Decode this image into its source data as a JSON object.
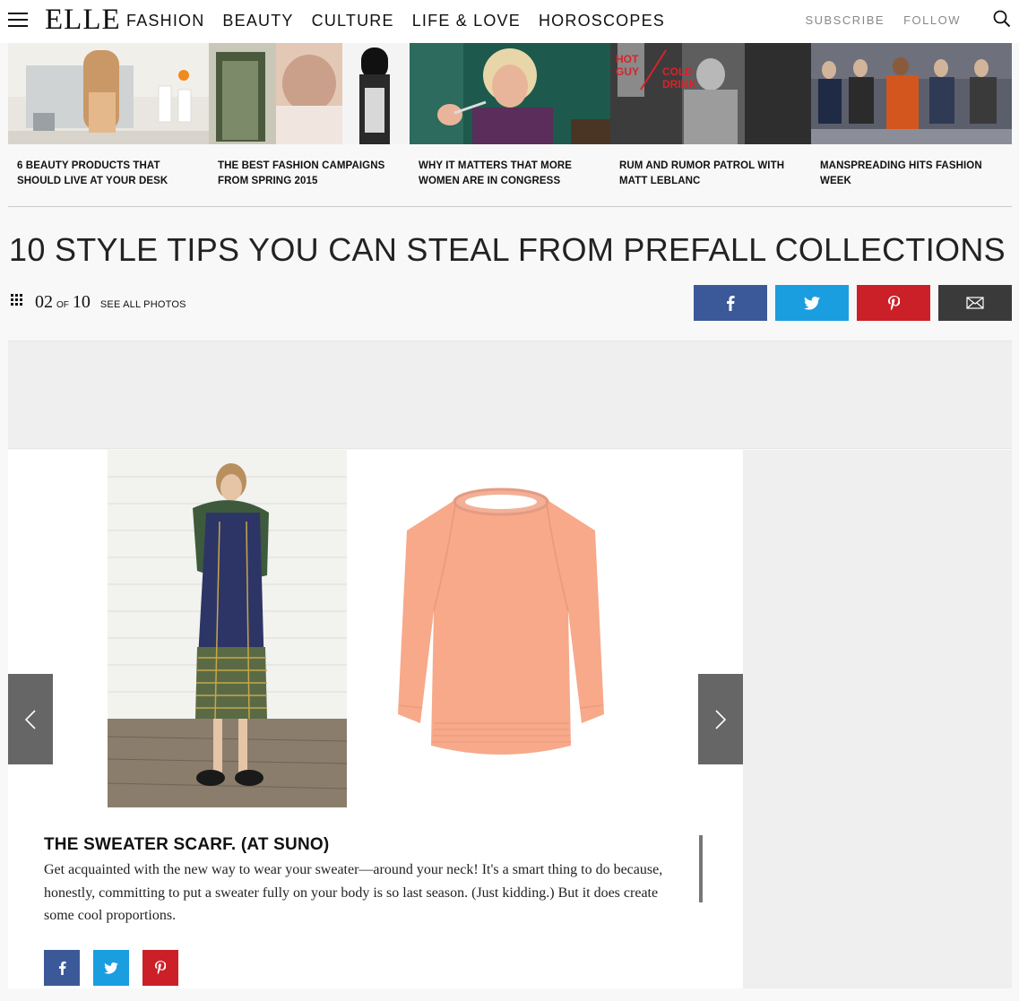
{
  "header": {
    "logo": "ELLE",
    "nav": [
      "FASHION",
      "BEAUTY",
      "CULTURE",
      "LIFE & LOVE",
      "HOROSCOPES"
    ],
    "subscribe": "SUBSCRIBE",
    "follow": "FOLLOW"
  },
  "promos": [
    {
      "caption": "6 BEAUTY PRODUCTS THAT SHOULD LIVE AT YOUR DESK"
    },
    {
      "caption": "THE BEST FASHION CAMPAIGNS FROM SPRING 2015"
    },
    {
      "caption": "WHY IT MATTERS THAT MORE WOMEN ARE IN CONGRESS"
    },
    {
      "caption": "RUM AND RUMOR PATROL WITH MATT LEBLANC",
      "overlay_text": [
        "HOT",
        "GUY",
        "COLD",
        "DRINK"
      ]
    },
    {
      "caption": "MANSPREADING HITS FASHION WEEK"
    }
  ],
  "gallery": {
    "title": "10 STYLE TIPS YOU CAN STEAL FROM PREFALL COLLECTIONS",
    "current": "02",
    "of": "OF",
    "total": "10",
    "see_all": "SEE ALL PHOTOS"
  },
  "slide": {
    "title": "THE SWEATER SCARF. (AT SUNO)",
    "body": "Get acquainted with the new way to wear your sweater—around your neck! It's a smart thing to do because, honestly, committing to put a sweater fully on your body is so last season. (Just kidding.) But it does create some cool proportions."
  },
  "colors": {
    "facebook": "#3b5998",
    "twitter": "#1a9ee0",
    "pinterest": "#cb2027",
    "email": "#3a3a3a",
    "sweater": "#f7a98a"
  },
  "icons": [
    "menu-icon",
    "search-icon",
    "grid-icon",
    "facebook-icon",
    "twitter-icon",
    "pinterest-icon",
    "email-icon",
    "chevron-left-icon",
    "chevron-right-icon"
  ]
}
